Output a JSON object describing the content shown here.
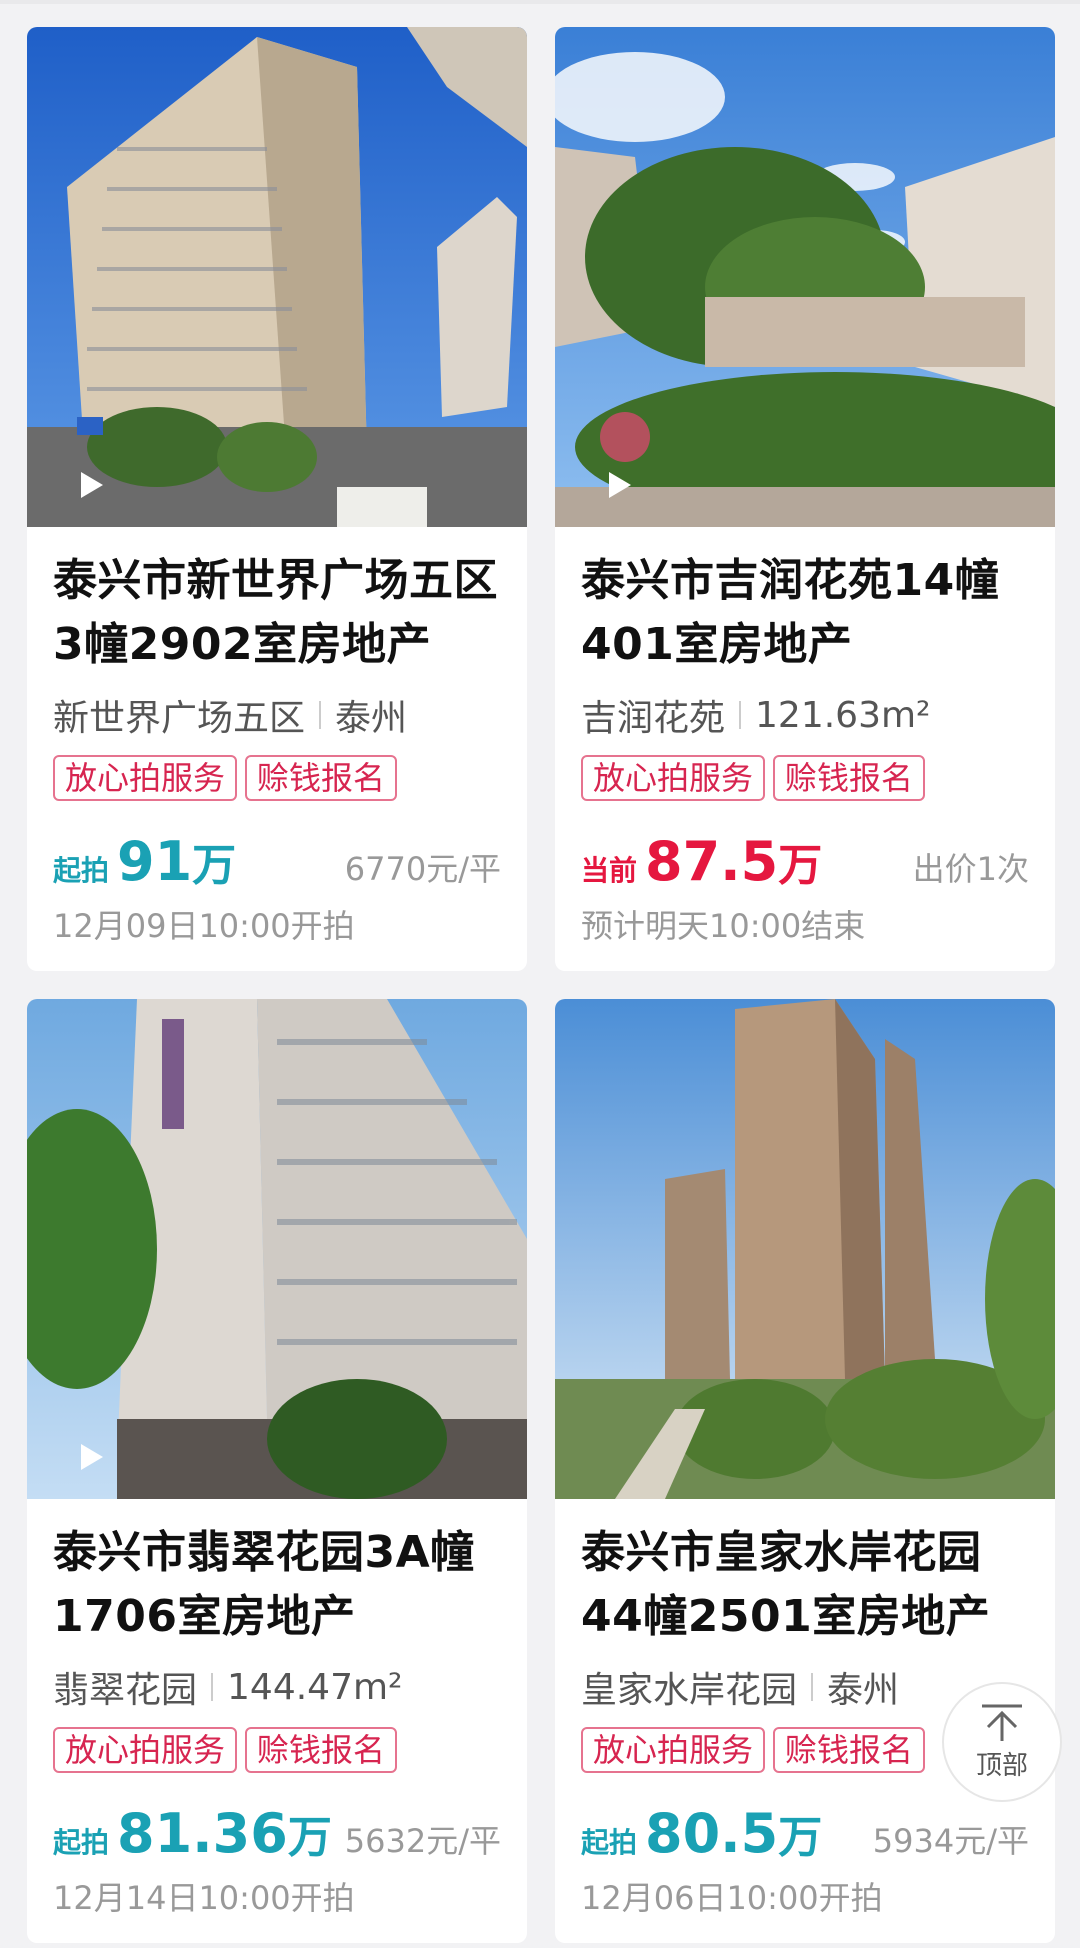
{
  "listings": [
    {
      "title": "泰兴市新世界广场五区3幢2902室房地产",
      "community": "新世界广场五区",
      "detail": "泰州",
      "tags": [
        "放心拍服务",
        "赊钱报名"
      ],
      "price_label": "起拍",
      "price_value": "91",
      "price_unit": "万",
      "price_right": "6770元/平",
      "time": "12月09日10:00开拍",
      "status_color": "#1aa1b4"
    },
    {
      "title": "泰兴市吉润花苑14幢401室房地产",
      "community": "吉润花苑",
      "detail": "121.63m²",
      "tags": [
        "放心拍服务",
        "赊钱报名"
      ],
      "price_label": "当前",
      "price_value": "87.5",
      "price_unit": "万",
      "price_right": "出价1次",
      "time": "预计明天10:00结束",
      "status_color": "#e5173f"
    },
    {
      "title": "泰兴市翡翠花园3A幢1706室房地产",
      "community": "翡翠花园",
      "detail": "144.47m²",
      "tags": [
        "放心拍服务",
        "赊钱报名"
      ],
      "price_label": "起拍",
      "price_value": "81.36",
      "price_unit": "万",
      "price_right": "5632元/平",
      "time": "12月14日10:00开拍",
      "status_color": "#1aa1b4"
    },
    {
      "title": "泰兴市皇家水岸花园44幢2501室房地产",
      "community": "皇家水岸花园",
      "detail": "泰州",
      "tags": [
        "放心拍服务",
        "赊钱报名"
      ],
      "price_label": "起拍",
      "price_value": "80.5",
      "price_unit": "万",
      "price_right": "5934元/平",
      "time": "12月06日10:00开拍",
      "status_color": "#1aa1b4"
    }
  ],
  "top_button": {
    "label": "顶部",
    "icon": "arrow-up-icon"
  },
  "icons": {
    "play": "play-icon"
  }
}
